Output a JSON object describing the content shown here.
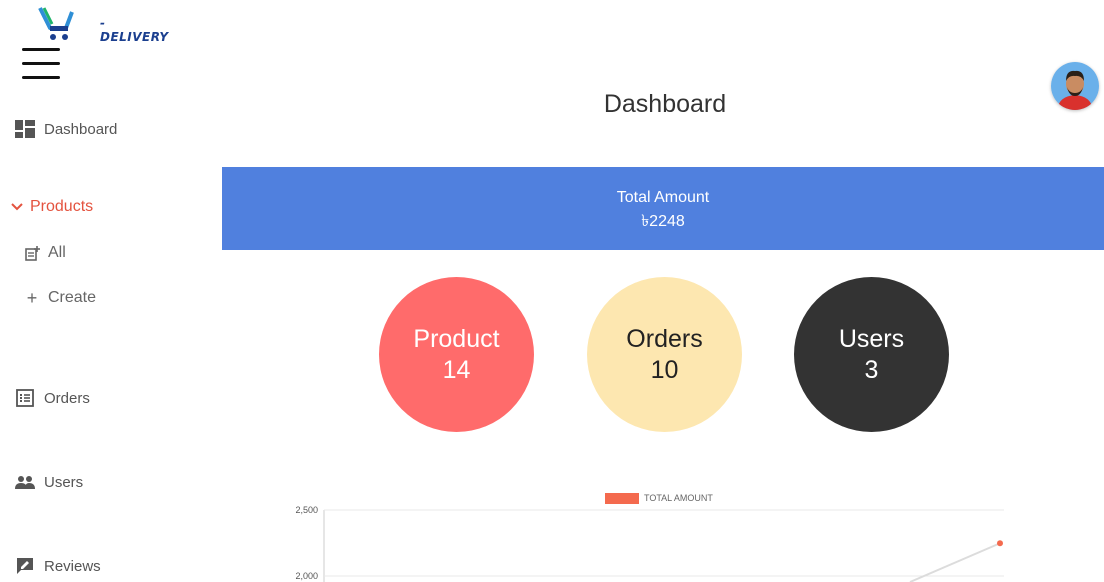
{
  "brand": {
    "logo_text": "-DELIVERY",
    "accent_color": "#e4533f"
  },
  "sidebar": {
    "items": [
      {
        "label": "Dashboard",
        "icon": "dashboard-icon"
      },
      {
        "label": "Products",
        "icon": "chevron-down-icon"
      },
      {
        "label": "All",
        "icon": "post-add-icon"
      },
      {
        "label": "Create",
        "icon": "plus-icon"
      },
      {
        "label": "Orders",
        "icon": "list-alt-icon"
      },
      {
        "label": "Users",
        "icon": "people-icon"
      },
      {
        "label": "Reviews",
        "icon": "rate-review-icon"
      }
    ]
  },
  "header": {
    "title": "Dashboard"
  },
  "summary": {
    "total_amount_label": "Total Amount",
    "total_amount_value": "৳2248",
    "banner_color": "#5080de"
  },
  "stats": [
    {
      "label": "Product",
      "value": "14",
      "color": "#ff6b6b"
    },
    {
      "label": "Orders",
      "value": "10",
      "color": "#fde7b0"
    },
    {
      "label": "Users",
      "value": "3",
      "color": "#333333"
    }
  ],
  "chart_data": {
    "type": "line",
    "series": [
      {
        "name": "TOTAL AMOUNT",
        "color": "#f46a4e",
        "x": [
          0,
          1
        ],
        "values": [
          0,
          2248
        ]
      }
    ],
    "y_ticks": [
      "2,500",
      "2,000"
    ],
    "ylim": [
      0,
      2500
    ],
    "legend_position": "top"
  }
}
